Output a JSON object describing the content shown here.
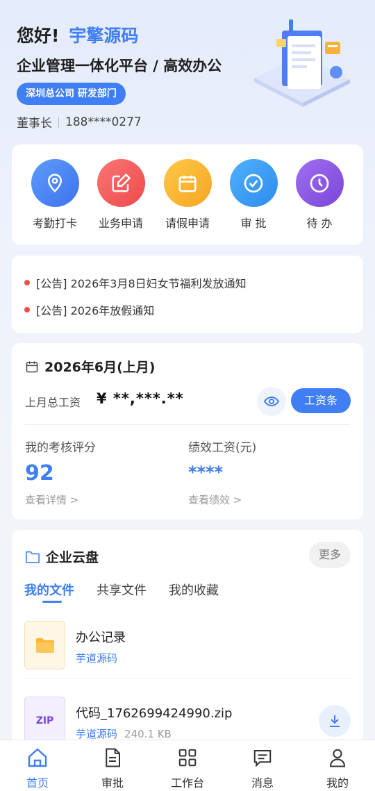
{
  "header": {
    "greeting": "您好!",
    "company_name": "宇擎源码",
    "subtitle": "企业管理一体化平台 / 高效办公",
    "department": "深圳总公司 研发部门",
    "role": "董事长",
    "phone": "188****0277"
  },
  "quick_actions": [
    {
      "label": "考勤打卡",
      "icon": "location-pin-icon",
      "color": "#4d8af5"
    },
    {
      "label": "业务申请",
      "icon": "edit-icon",
      "color": "#f45f5f"
    },
    {
      "label": "请假申请",
      "icon": "calendar-icon",
      "color": "#fbb634"
    },
    {
      "label": "审 批",
      "icon": "check-circle-icon",
      "color": "#3a9df5"
    },
    {
      "label": "待 办",
      "icon": "clock-icon",
      "color": "#8a5be0"
    }
  ],
  "notices": [
    {
      "text": "[公告] 2026年3月8日妇女节福利发放通知"
    },
    {
      "text": "[公告] 2026年放假通知"
    }
  ],
  "salary": {
    "period": "2026年6月(上月)",
    "total_label": "上月总工资",
    "total_value": "¥ **,***.**",
    "slip_button": "工资条",
    "score_label": "我的考核评分",
    "score_value": "92",
    "score_link": "查看详情 >",
    "perf_label": "绩效工资(元)",
    "perf_value": "****",
    "perf_link": "查看绩效 >"
  },
  "cloud": {
    "title": "企业云盘",
    "more": "更多",
    "tabs": [
      "我的文件",
      "共享文件",
      "我的收藏"
    ],
    "active_tab": 0,
    "files": [
      {
        "name": "办公记录",
        "owner": "芋道源码",
        "size": "",
        "type": "folder"
      },
      {
        "name": "代码_1762699424990.zip",
        "owner": "芋道源码",
        "size": "240.1 KB",
        "type": "ZIP"
      }
    ]
  },
  "tabbar": [
    {
      "label": "首页",
      "icon": "home-icon",
      "active": true
    },
    {
      "label": "审批",
      "icon": "document-icon",
      "active": false
    },
    {
      "label": "工作台",
      "icon": "grid-icon",
      "active": false
    },
    {
      "label": "消息",
      "icon": "message-icon",
      "active": false
    },
    {
      "label": "我的",
      "icon": "user-icon",
      "active": false
    }
  ],
  "colors": {
    "accent": "#3f7ef3",
    "notice_dot": "#ef4d4d"
  }
}
